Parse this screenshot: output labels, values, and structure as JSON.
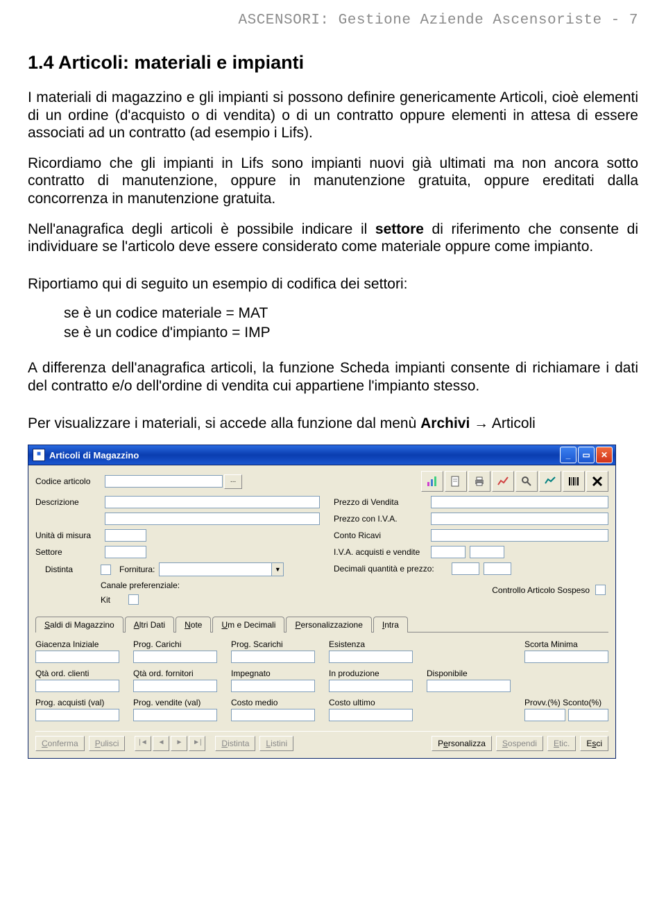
{
  "header": "ASCENSORI: Gestione Aziende Ascensoriste -  7",
  "section_title": "1.4    Articoli: materiali e impianti",
  "p1": "I materiali di magazzino e gli impianti si possono definire genericamente Articoli, cioè elementi di un ordine (d'acquisto o di vendita) o di un contratto oppure elementi in attesa di essere associati ad un contratto (ad esempio i Lifs).",
  "p2": "Ricordiamo che gli impianti in Lifs sono impianti nuovi già ultimati ma non ancora sotto contratto di manutenzione, oppure in manutenzione gratuita, oppure ereditati dalla concorrenza in manutenzione gratuita.",
  "p3a": "Nell'anagrafica degli articoli è possibile indicare il ",
  "p3_bold": "settore",
  "p3b": " di riferimento che consente di individuare se l'articolo deve essere considerato come materiale oppure come impianto.",
  "p4": "Riportiamo qui di seguito un esempio di codifica dei settori:",
  "li1": "se è un codice materiale = MAT",
  "li2": "se è un codice d'impianto = IMP",
  "p5": "A differenza dell'anagrafica articoli, la funzione Scheda impianti consente di richiamare i dati del contratto e/o dell'ordine di vendita cui appartiene l'impianto stesso.",
  "p6a": "Per visualizzare i materiali, si accede alla funzione dal menù ",
  "p6_bold": "Archivi",
  "p6b": " → Articoli",
  "window": {
    "title": "Articoli di Magazzino",
    "labels": {
      "codice": "Codice articolo",
      "descrizione": "Descrizione",
      "unita": "Unità di misura",
      "settore": "Settore",
      "distinta": "Distinta",
      "fornitura": "Fornitura:",
      "canale": "Canale preferenziale:",
      "kit": "Kit",
      "prezzo_vendita": "Prezzo di Vendita",
      "prezzo_iva": "Prezzo con I.V.A.",
      "conto_ricavi": "Conto Ricavi",
      "iva_acq": "I.V.A. acquisti e vendite",
      "decimali": "Decimali quantità e prezzo:",
      "controllo": "Controllo Articolo Sospeso"
    },
    "tabs": [
      "Saldi di Magazzino",
      "Altri Dati",
      "Note",
      "Um e Decimali",
      "Personalizzazione",
      "Intra"
    ],
    "row1": [
      "Giacenza Iniziale",
      "Prog. Carichi",
      "Prog. Scarichi",
      "Esistenza",
      "",
      "Scorta Minima"
    ],
    "row2": [
      "Qtà ord. clienti",
      "Qtà ord. fornitori",
      "Impegnato",
      "In produzione",
      "Disponibile",
      ""
    ],
    "row3": [
      "Prog. acquisti (val)",
      "Prog. vendite (val)",
      "Costo medio",
      "Costo ultimo",
      "",
      "Provv.(%)  Sconto(%)"
    ],
    "bottom": {
      "conferma": "Conferma",
      "pulisci": "Pulisci",
      "distinta": "Distinta",
      "listini": "Listini",
      "personalizza": "Personalizza",
      "sospendi": "Sospendi",
      "etic": "Etic.",
      "esci": "Esci"
    }
  }
}
